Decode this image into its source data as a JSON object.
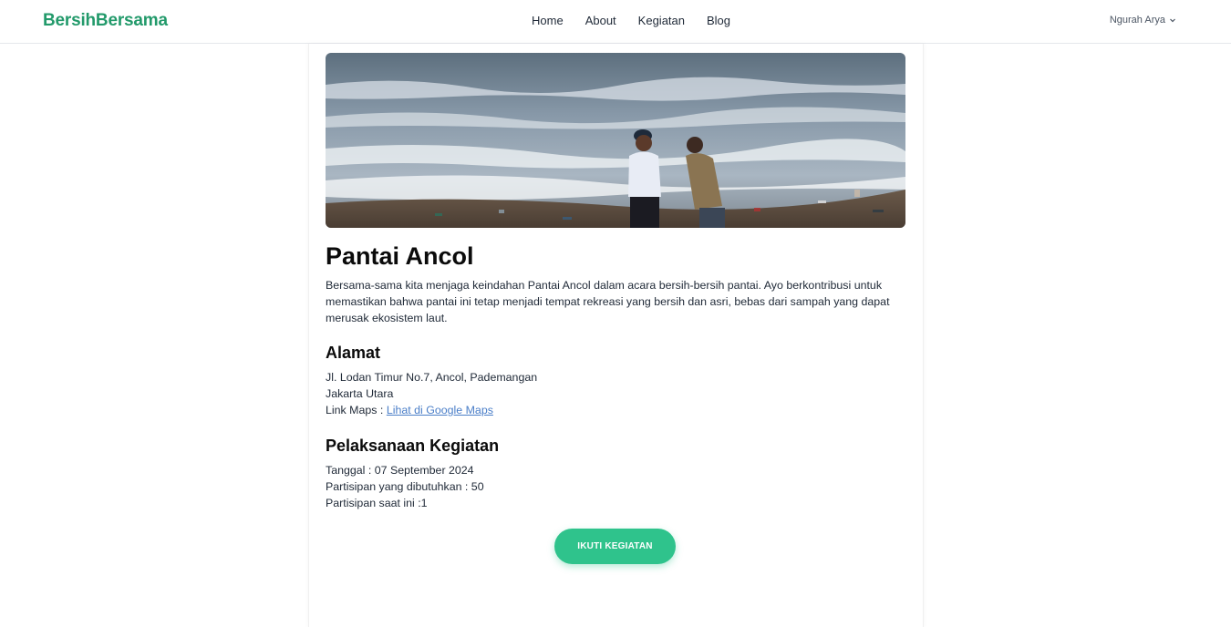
{
  "nav": {
    "brand": "BersihBersama",
    "links": [
      "Home",
      "About",
      "Kegiatan",
      "Blog"
    ],
    "user_name": "Ngurah Arya"
  },
  "event": {
    "title": "Pantai Ancol",
    "description": "Bersama-sama kita menjaga keindahan Pantai Ancol dalam acara bersih-bersih pantai. Ayo berkontribusi untuk memastikan bahwa pantai ini tetap menjadi tempat rekreasi yang bersih dan asri, bebas dari sampah yang dapat merusak ekosistem laut.",
    "image_alt": "Dua orang di pantai berombak dengan sampah di pasir",
    "address": {
      "heading": "Alamat",
      "line1": "Jl. Lodan Timur No.7, Ancol, Pademangan",
      "line2": "Jakarta Utara",
      "maps_label": "Link Maps : ",
      "maps_link_text": "Lihat di Google Maps"
    },
    "schedule": {
      "heading": "Pelaksanaan Kegiatan",
      "date": "Tanggal : 07 September 2024",
      "needed": "Partisipan yang dibutuhkan : 50",
      "current": "Partisipan saat ini :1"
    },
    "join_label": "IKUTI KEGIATAN"
  },
  "colors": {
    "brand": "#239a6b",
    "button": "#2fc38c",
    "link": "#4a7ec8"
  }
}
